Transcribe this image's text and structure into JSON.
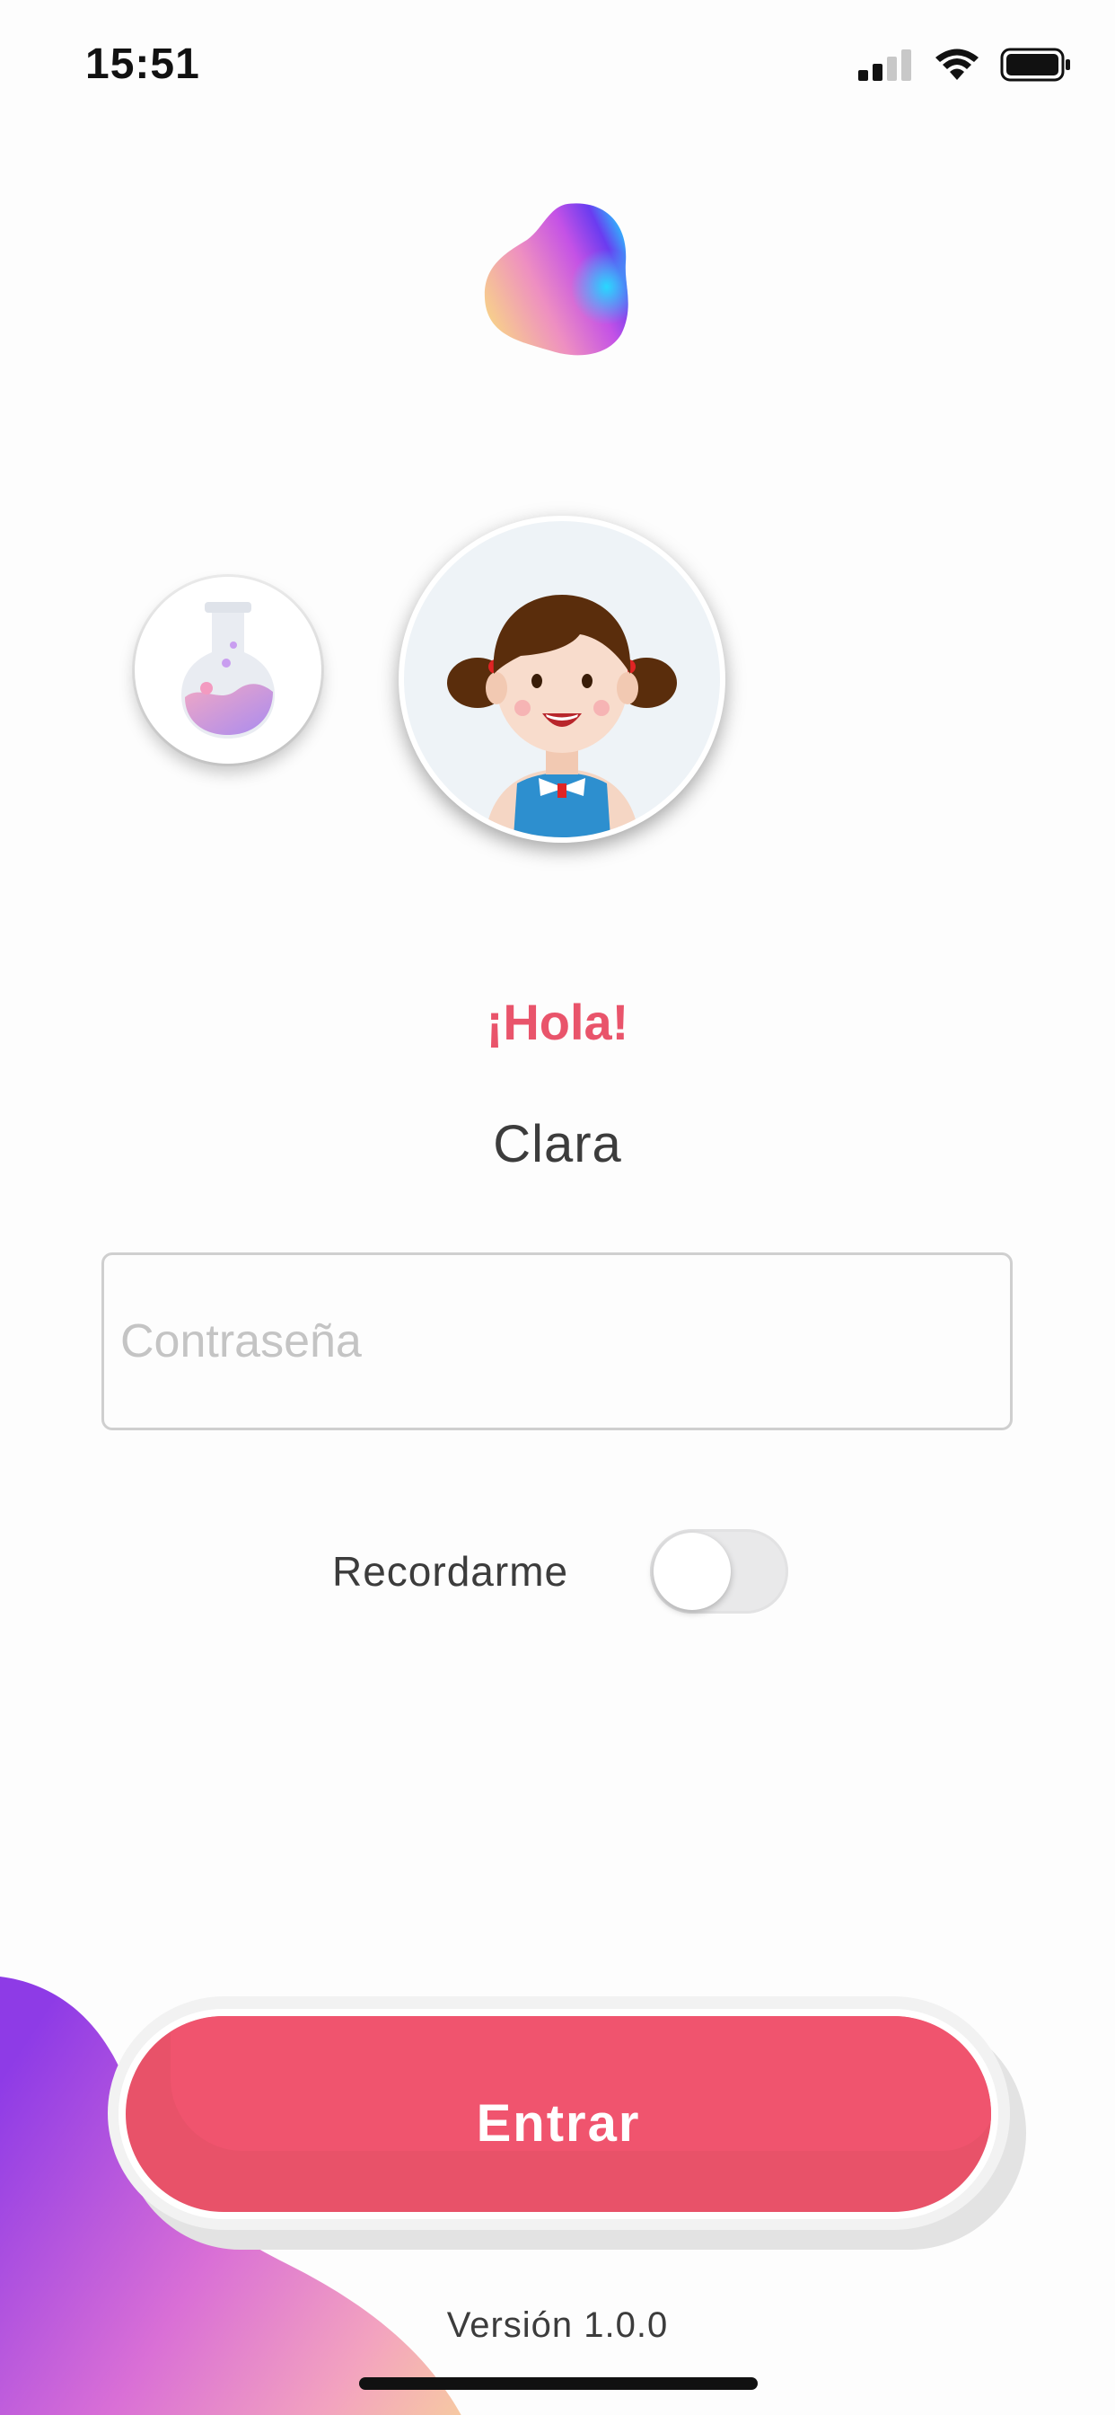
{
  "status_bar": {
    "time": "15:51",
    "icons": [
      "cellular-signal-icon",
      "wifi-icon",
      "battery-icon"
    ]
  },
  "logo": {
    "icon": "blob-logo-icon"
  },
  "avatars": {
    "secondary": {
      "icon": "flask-icon"
    },
    "selected": {
      "icon": "girl-avatar-icon"
    }
  },
  "login": {
    "greeting": "¡Hola!",
    "username": "Clara",
    "password_placeholder": "Contraseña",
    "password_value": "",
    "remember_label": "Recordarme",
    "remember_enabled": false,
    "submit_label": "Entrar"
  },
  "footer": {
    "version": "Versión 1.0.0"
  },
  "colors": {
    "accent": "#e85269",
    "greeting": "#e9546b",
    "text": "#3c3c3c",
    "placeholder": "#c4c4c4"
  }
}
